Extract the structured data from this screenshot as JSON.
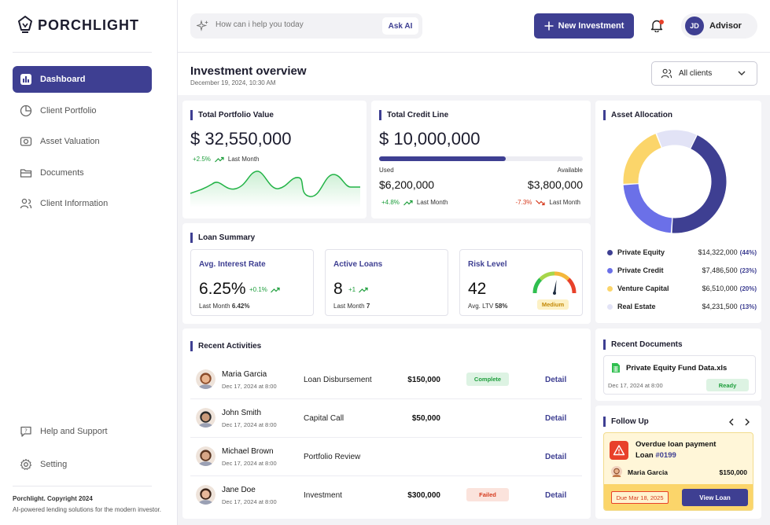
{
  "brand": {
    "name": "PORCHLIGHT",
    "footer_bold": "Porchlight. Copyright 2024",
    "footer_sub": "AI-powered lending solutions for the modern investor."
  },
  "sidebar": {
    "items": [
      {
        "label": "Dashboard",
        "icon": "chart-bar-icon",
        "active": true
      },
      {
        "label": "Client Portfolio",
        "icon": "pie-chart-icon"
      },
      {
        "label": "Asset Valuation",
        "icon": "camera-icon"
      },
      {
        "label": "Documents",
        "icon": "folder-icon"
      },
      {
        "label": "Client Information",
        "icon": "users-icon"
      }
    ],
    "bottom": [
      {
        "label": "Help and Support",
        "icon": "help-icon"
      },
      {
        "label": "Setting",
        "icon": "gear-icon"
      }
    ]
  },
  "topbar": {
    "search_placeholder": "How can i help you today",
    "ask_ai": "Ask AI",
    "new_investment": "New Investment",
    "profile_initials": "JD",
    "profile_name": "Advisor"
  },
  "header": {
    "title": "Investment overview",
    "date": "December 19, 2024, 10:30 AM",
    "client_filter": "All clients"
  },
  "portfolio": {
    "title": "Total Portfolio Value",
    "value": "$ 32,550,000",
    "change": "+2.5%",
    "period": "Last Month"
  },
  "credit": {
    "title": "Total Credit Line",
    "value": "$ 10,000,000",
    "used_label": "Used",
    "available_label": "Available",
    "used": "$6,200,000",
    "available": "$3,800,000",
    "used_change": "+4.8%",
    "available_change": "-7.3%",
    "period": "Last Month",
    "used_fraction": 0.62
  },
  "loan": {
    "title": "Loan Summary",
    "interest": {
      "title": "Avg. Interest Rate",
      "value": "6.25%",
      "change": "+0.1%",
      "sub_label": "Last Month",
      "sub_value": "6.42%"
    },
    "active": {
      "title": "Active Loans",
      "value": "8",
      "change": "+1",
      "sub_label": "Last Month",
      "sub_value": "7"
    },
    "risk": {
      "title": "Risk Level",
      "value": "42",
      "sub_label": "Avg. LTV",
      "sub_value": "58%",
      "badge": "Medium"
    }
  },
  "allocation": {
    "title": "Asset Allocation",
    "items": [
      {
        "name": "Private Equity",
        "value": "$14,322,000",
        "pct": "(44%)",
        "share": 44,
        "color": "#3e3f92"
      },
      {
        "name": "Private Credit",
        "value": "$7,486,500",
        "pct": "(23%)",
        "share": 23,
        "color": "#6b70e8"
      },
      {
        "name": "Venture Capital",
        "value": "$6,510,000",
        "pct": "(20%)",
        "share": 20,
        "color": "#fbd56a"
      },
      {
        "name": "Real Estate",
        "value": "$4,231,500",
        "pct": "(13%)",
        "share": 13,
        "color": "#e2e3f6"
      }
    ]
  },
  "activities": {
    "title": "Recent Activities",
    "rows": [
      {
        "name": "Maria Garcia",
        "date": "Dec 17, 2024 at 8:00",
        "type": "Loan Disbursement",
        "amount": "$150,000",
        "status": "Complete",
        "status_kind": "ok",
        "action": "Detail",
        "skin": "#e9b48e",
        "hair": "#8a4b2a"
      },
      {
        "name": "John Smith",
        "date": "Dec 17, 2024 at 8:00",
        "type": "Capital Call",
        "amount": "$50,000",
        "status": "",
        "status_kind": "",
        "action": "Detail",
        "skin": "#c99a7a",
        "hair": "#2a2a2a"
      },
      {
        "name": "Michael Brown",
        "date": "Dec 17, 2024 at 8:00",
        "type": "Portfolio Review",
        "amount": "",
        "status": "",
        "status_kind": "",
        "action": "Detail",
        "skin": "#d7a686",
        "hair": "#5a3520"
      },
      {
        "name": "Jane Doe",
        "date": "Dec 17, 2024 at 8:00",
        "type": "Investment",
        "amount": "$300,000",
        "status": "Failed",
        "status_kind": "fail",
        "action": "Detail",
        "skin": "#e7b89a",
        "hair": "#3b2418"
      }
    ]
  },
  "documents": {
    "title": "Recent Documents",
    "file_name": "Private Equity Fund Data.xls",
    "date": "Dec 17, 2024 at 8:00",
    "status": "Ready"
  },
  "followup": {
    "title": "Follow Up",
    "heading": "Overdue loan payment",
    "loan_label": "Loan",
    "loan_no": "#0199",
    "person": "Maria Garcia",
    "amount": "$150,000",
    "due": "Due Mar 18, 2025",
    "action": "View Loan"
  }
}
